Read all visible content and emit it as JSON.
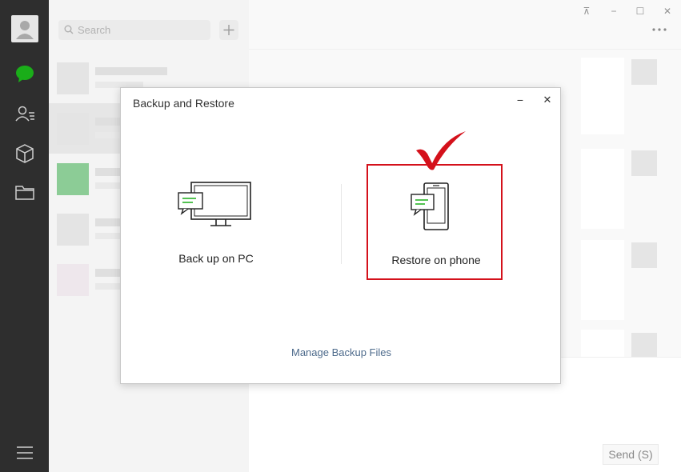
{
  "search": {
    "placeholder": "Search"
  },
  "window_controls": {
    "pin": "⊼",
    "minimize": "−",
    "maximize": "☐",
    "close": "✕"
  },
  "more_menu": "⋮⋯",
  "dialog": {
    "title": "Backup and Restore",
    "minimize": "−",
    "close": "✕",
    "backup_label": "Back up on PC",
    "restore_label": "Restore on phone",
    "manage_label": "Manage Backup Files"
  },
  "send_button": "Send (S)",
  "colors": {
    "highlight": "#d4111b",
    "accent": "#1aad19",
    "link": "#4e6b8c"
  }
}
